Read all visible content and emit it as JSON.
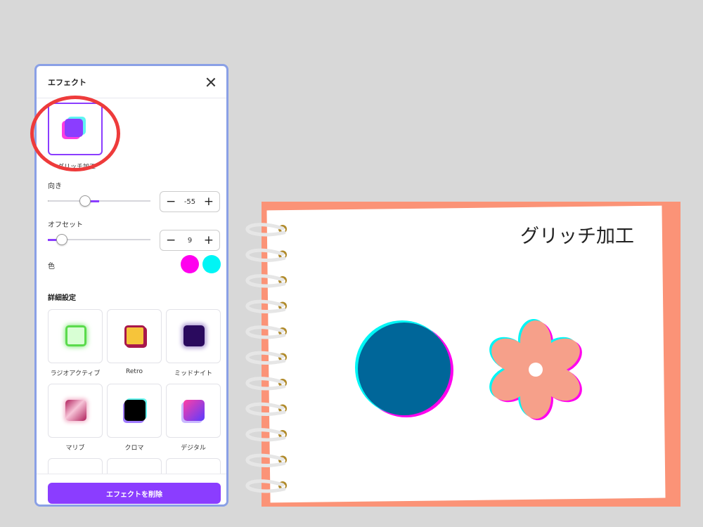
{
  "panel": {
    "title": "エフェクト",
    "selected_effect_label": "グリッチ加工",
    "direction": {
      "label": "向き",
      "value": "-55"
    },
    "offset": {
      "label": "オフセット",
      "value": "9"
    },
    "color": {
      "label": "色",
      "swatches": [
        "#ff00ee",
        "#00f5f5"
      ]
    },
    "advanced_title": "詳細設定",
    "presets": [
      {
        "label": "ラジオアクティブ",
        "icon": "radioactive-preset-icon"
      },
      {
        "label": "Retro",
        "icon": "retro-preset-icon"
      },
      {
        "label": "ミッドナイト",
        "icon": "midnight-preset-icon"
      },
      {
        "label": "マリブ",
        "icon": "malibu-preset-icon"
      },
      {
        "label": "クロマ",
        "icon": "chroma-preset-icon"
      },
      {
        "label": "デジタル",
        "icon": "digital-preset-icon"
      }
    ],
    "delete_label": "エフェクトを削除"
  },
  "canvas": {
    "page_title": "グリッチ加工",
    "colors": {
      "notebook": "#fb9377",
      "circle": "#006699",
      "flower": "#f6a08a",
      "accent": "#8b3dff"
    }
  }
}
